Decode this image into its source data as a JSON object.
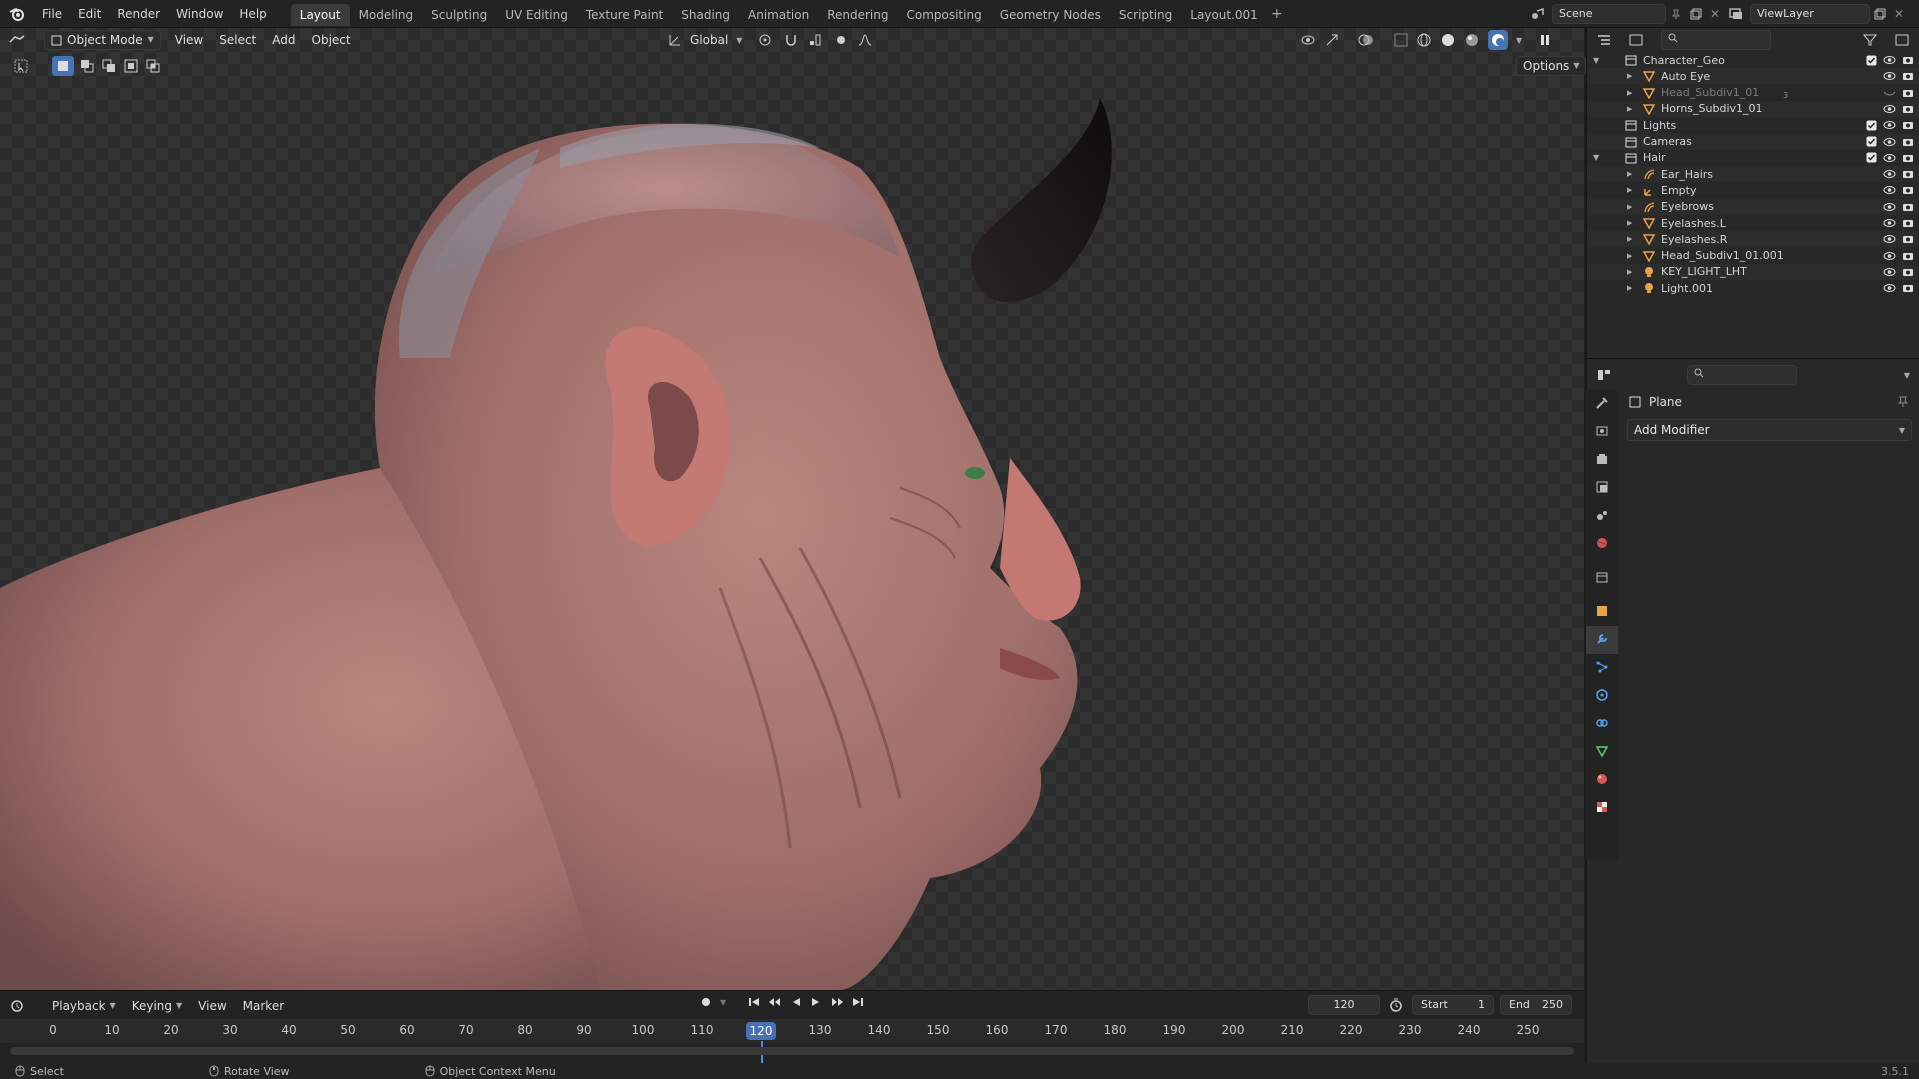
{
  "menubar": {
    "items": [
      "File",
      "Edit",
      "Render",
      "Window",
      "Help"
    ]
  },
  "workspaces": {
    "tabs": [
      "Layout",
      "Modeling",
      "Sculpting",
      "UV Editing",
      "Texture Paint",
      "Shading",
      "Animation",
      "Rendering",
      "Compositing",
      "Geometry Nodes",
      "Scripting",
      "Layout.001"
    ],
    "active": "Layout"
  },
  "scene": {
    "name": "Scene"
  },
  "viewlayer": {
    "name": "ViewLayer"
  },
  "viewport": {
    "mode": "Object Mode",
    "menus": [
      "View",
      "Select",
      "Add",
      "Object"
    ],
    "orientation": "Global",
    "options_label": "Options"
  },
  "outliner": {
    "rows": [
      {
        "label": "Character_Geo",
        "indent": 1,
        "kind": "collection",
        "expanded": true,
        "dim": false
      },
      {
        "label": "Auto Eye",
        "indent": 2,
        "kind": "mesh",
        "dim": false
      },
      {
        "label": "Head_Subdiv1_01",
        "indent": 2,
        "kind": "mesh",
        "dim": true
      },
      {
        "label": "Horns_Subdiv1_01",
        "indent": 2,
        "kind": "mesh",
        "dim": false
      },
      {
        "label": "Lights",
        "indent": 1,
        "kind": "collection",
        "dim": false
      },
      {
        "label": "Cameras",
        "indent": 1,
        "kind": "collection",
        "dim": false
      },
      {
        "label": "Hair",
        "indent": 1,
        "kind": "collection",
        "expanded": true,
        "dim": false
      },
      {
        "label": "Ear_Hairs",
        "indent": 2,
        "kind": "curves",
        "dim": false
      },
      {
        "label": "Empty",
        "indent": 2,
        "kind": "empty",
        "dim": false
      },
      {
        "label": "Eyebrows",
        "indent": 2,
        "kind": "curves",
        "dim": false
      },
      {
        "label": "Eyelashes.L",
        "indent": 2,
        "kind": "mesh",
        "dim": false
      },
      {
        "label": "Eyelashes.R",
        "indent": 2,
        "kind": "mesh",
        "dim": false
      },
      {
        "label": "Head_Subdiv1_01.001",
        "indent": 2,
        "kind": "mesh",
        "dim": false
      },
      {
        "label": "KEY_LIGHT_LHT",
        "indent": 2,
        "kind": "light",
        "dim": false
      },
      {
        "label": "Light.001",
        "indent": 2,
        "kind": "light",
        "dim": false
      }
    ],
    "head_subdiv_count": "3"
  },
  "properties": {
    "object_name": "Plane",
    "add_modifier_label": "Add Modifier"
  },
  "timeline": {
    "menus": [
      "Playback",
      "Keying",
      "View",
      "Marker"
    ],
    "current_frame": "120",
    "start_label": "Start",
    "start_value": "1",
    "end_label": "End",
    "end_value": "250",
    "ticks": [
      "0",
      "10",
      "20",
      "30",
      "40",
      "50",
      "60",
      "70",
      "80",
      "90",
      "100",
      "110",
      "120",
      "130",
      "140",
      "150",
      "160",
      "170",
      "180",
      "190",
      "200",
      "210",
      "220",
      "230",
      "240",
      "250"
    ]
  },
  "statusbar": {
    "select": "Select",
    "rotate": "Rotate View",
    "context": "Object Context Menu",
    "version": "3.5.1"
  },
  "colors": {
    "accent": "#4772b3",
    "mesh_icon": "#e8a24a",
    "collection_icon": "#e0e0e0",
    "curves_icon": "#e8a24a",
    "modifier_icon": "#5aa1f0",
    "data_icon": "#5ec96c",
    "playhead": "#4a90e2"
  }
}
